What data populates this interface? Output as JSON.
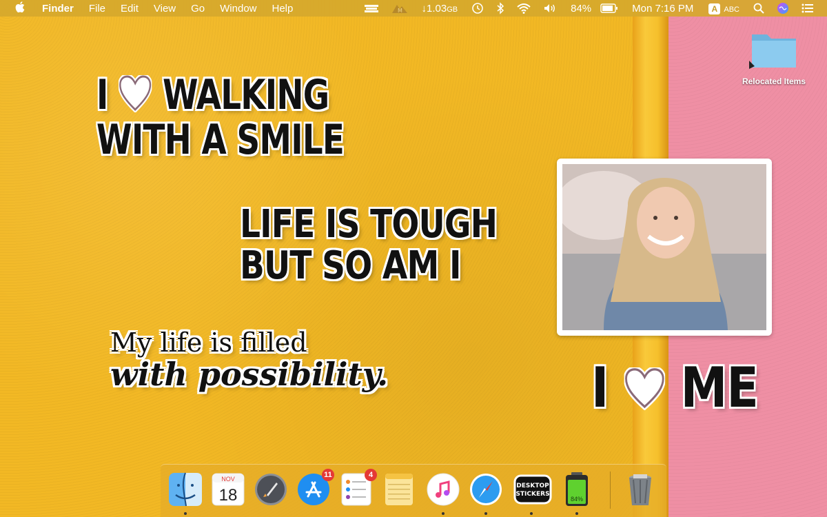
{
  "menubar": {
    "app_name": "Finder",
    "menus": [
      "File",
      "Edit",
      "View",
      "Go",
      "Window",
      "Help"
    ],
    "status": {
      "download": "↓1.03",
      "download_unit": "GB",
      "battery": "84%",
      "clock": "Mon 7:16 PM",
      "input_badge": "A",
      "input_source": "ABC"
    }
  },
  "stickers": {
    "walking_line1_a": "I",
    "walking_line1_b": "WALKING",
    "walking_line2": "WITH A SMILE",
    "tough_line1": "LIFE IS TOUGH",
    "tough_line2": "BUT SO AM I",
    "possibility_line1": "My life is filled",
    "possibility_line2": "with possibility.",
    "me_a": "I",
    "me_b": "ME"
  },
  "desktop": {
    "folder_label": "Relocated Items"
  },
  "dock": {
    "calendar_month": "NOV",
    "calendar_day": "18",
    "appstore_badge": "11",
    "reminders_badge": "4",
    "stickers_label_1": "DESKTOP",
    "stickers_label_2": "STICKERS",
    "battery_app_label": "84%"
  },
  "colors": {
    "wall_yellow": "#f2b824",
    "wall_pink": "#ef8fa4",
    "badge_red": "#e53935"
  }
}
